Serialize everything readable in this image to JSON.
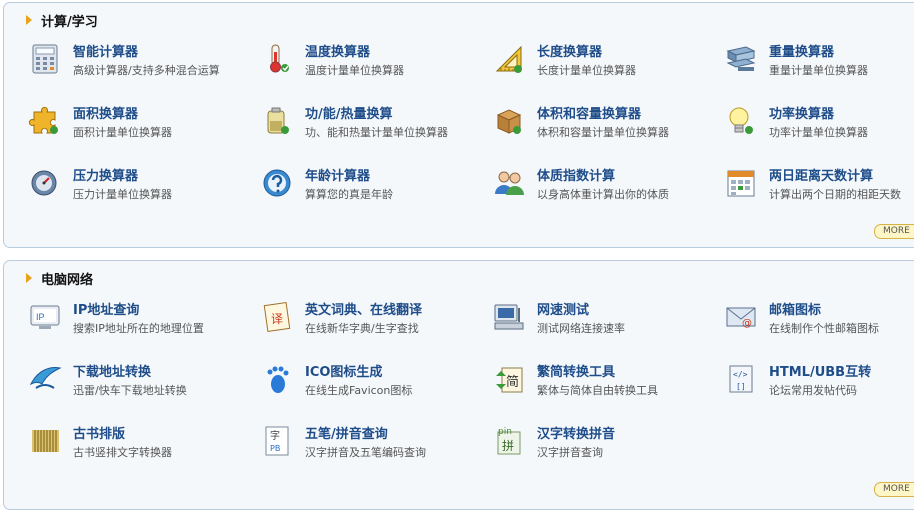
{
  "sections": [
    {
      "title": "计算/学习",
      "more_label": "MORE",
      "items": [
        {
          "name": "智能计算器",
          "desc": "高级计算器/支持多种混合运算",
          "icon": "calculator-icon"
        },
        {
          "name": "温度换算器",
          "desc": "温度计量单位换算器",
          "icon": "thermometer-icon"
        },
        {
          "name": "长度换算器",
          "desc": "长度计量单位换算器",
          "icon": "ruler-triangle-icon"
        },
        {
          "name": "重量换算器",
          "desc": "重量计量单位换算器",
          "icon": "steel-beam-icon"
        },
        {
          "name": "面积换算器",
          "desc": "面积计量单位换算器",
          "icon": "puzzle-icon"
        },
        {
          "name": "功/能/热量换算",
          "desc": "功、能和热量计量单位换算器",
          "icon": "battery-icon"
        },
        {
          "name": "体积和容量换算器",
          "desc": "体积和容量计量单位换算器",
          "icon": "box-icon"
        },
        {
          "name": "功率换算器",
          "desc": "功率计量单位换算器",
          "icon": "lightbulb-icon"
        },
        {
          "name": "压力换算器",
          "desc": "压力计量单位换算器",
          "icon": "pressure-gauge-icon"
        },
        {
          "name": "年龄计算器",
          "desc": "算算您的真是年龄",
          "icon": "help-circle-icon"
        },
        {
          "name": "体质指数计算",
          "desc": "以身高体重计算出你的体质",
          "icon": "users-icon"
        },
        {
          "name": "两日距离天数计算",
          "desc": "计算出两个日期的相距天数",
          "icon": "calendar-icon"
        }
      ]
    },
    {
      "title": "电脑网络",
      "more_label": "MORE",
      "items": [
        {
          "name": "IP地址查询",
          "desc": "搜索IP地址所在的地理位置",
          "icon": "ip-monitor-icon"
        },
        {
          "name": "英文词典、在线翻译",
          "desc": "在线新华字典/生字查找",
          "icon": "translate-icon"
        },
        {
          "name": "网速测试",
          "desc": "测试网络连接速率",
          "icon": "network-computer-icon"
        },
        {
          "name": "邮箱图标",
          "desc": "在线制作个性邮箱图标",
          "icon": "email-icon"
        },
        {
          "name": "下载地址转换",
          "desc": "迅雷/快车下载地址转换",
          "icon": "download-bird-icon"
        },
        {
          "name": "ICO图标生成",
          "desc": "在线生成Favicon图标",
          "icon": "footprint-icon"
        },
        {
          "name": "繁简转换工具",
          "desc": "繁体与简体自由转换工具",
          "icon": "convert-text-icon"
        },
        {
          "name": "HTML/UBB互转",
          "desc": "论坛常用发帖代码",
          "icon": "code-convert-icon"
        },
        {
          "name": "古书排版",
          "desc": "古书竖排文字转换器",
          "icon": "bamboo-book-icon"
        },
        {
          "name": "五笔/拼音查询",
          "desc": "汉字拼音及五笔编码查询",
          "icon": "char-lookup-icon"
        },
        {
          "name": "汉字转换拼音",
          "desc": "汉字拼音查询",
          "icon": "pinyin-icon"
        }
      ]
    }
  ]
}
